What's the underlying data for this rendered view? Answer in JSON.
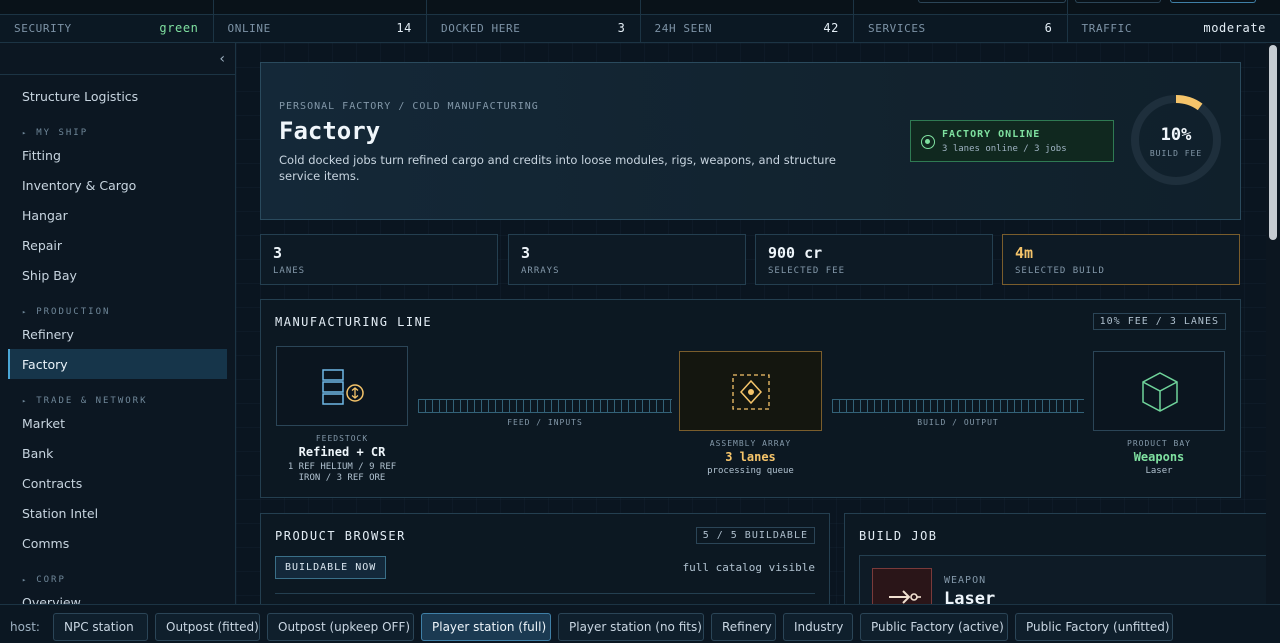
{
  "status": [
    {
      "key": "SECURITY",
      "value": "green",
      "accent": true
    },
    {
      "key": "ONLINE",
      "value": "14"
    },
    {
      "key": "DOCKED HERE",
      "value": "3"
    },
    {
      "key": "24H SEEN",
      "value": "42"
    },
    {
      "key": "SERVICES",
      "value": "6"
    },
    {
      "key": "TRAFFIC",
      "value": "moderate"
    }
  ],
  "sidebar": {
    "collapse_icon": "‹",
    "items": [
      {
        "label": "Structure Logistics"
      },
      {
        "group": "MY SHIP"
      },
      {
        "label": "Fitting"
      },
      {
        "label": "Inventory & Cargo"
      },
      {
        "label": "Hangar"
      },
      {
        "label": "Repair"
      },
      {
        "label": "Ship Bay"
      },
      {
        "group": "PRODUCTION"
      },
      {
        "label": "Refinery"
      },
      {
        "label": "Factory",
        "active": true
      },
      {
        "group": "TRADE & NETWORK"
      },
      {
        "label": "Market"
      },
      {
        "label": "Bank"
      },
      {
        "label": "Contracts"
      },
      {
        "label": "Station Intel"
      },
      {
        "label": "Comms"
      },
      {
        "group": "CORP"
      },
      {
        "label": "Overview"
      }
    ]
  },
  "hero": {
    "crumb": "PERSONAL FACTORY / COLD MANUFACTURING",
    "title": "Factory",
    "desc": "Cold docked jobs turn refined cargo and credits into loose modules, rigs, weapons, and structure service items.",
    "online_title": "FACTORY ONLINE",
    "online_sub": "3 lanes online / 3 jobs",
    "gauge_value": "10%",
    "gauge_label": "BUILD FEE",
    "gauge_fraction": 0.1
  },
  "kpis": [
    {
      "value": "3",
      "label": "LANES"
    },
    {
      "value": "3",
      "label": "ARRAYS"
    },
    {
      "value": "900 cr",
      "label": "SELECTED FEE"
    },
    {
      "value": "4m",
      "label": "SELECTED BUILD",
      "highlight": true
    }
  ],
  "line": {
    "title": "MANUFACTURING LINE",
    "chip": "10% FEE / 3 LANES",
    "feed_label": "FEEDSTOCK",
    "feed_value": "Refined + CR",
    "feed_sub": "1 REF HELIUM / 9 REF IRON / 3 REF ORE",
    "rail1": "FEED / INPUTS",
    "assembly_label": "ASSEMBLY ARRAY",
    "assembly_value": "3 lanes",
    "assembly_sub": "processing queue",
    "rail2": "BUILD / OUTPUT",
    "bay_label": "PRODUCT BAY",
    "bay_value": "Weapons",
    "bay_sub": "Laser"
  },
  "browser": {
    "title": "PRODUCT BROWSER",
    "chip": "5 / 5 BUILDABLE",
    "filter": "BUILDABLE NOW",
    "note": "full catalog visible"
  },
  "job": {
    "title": "BUILD JOB",
    "kind": "WEAPON",
    "name": "Laser"
  },
  "host": {
    "label": "host:",
    "options": [
      "NPC station",
      "Outpost (fitted)",
      "Outpost (upkeep OFF)",
      "Player station (full)",
      "Player station (no fits)",
      "Refinery",
      "Industry",
      "Public Factory (active)",
      "Public Factory (unfitted)"
    ],
    "active": 3
  },
  "colors": {
    "accent_green": "#7fe0a0",
    "accent_amber": "#f5c46a",
    "accent_blue": "#4aa6d6"
  }
}
